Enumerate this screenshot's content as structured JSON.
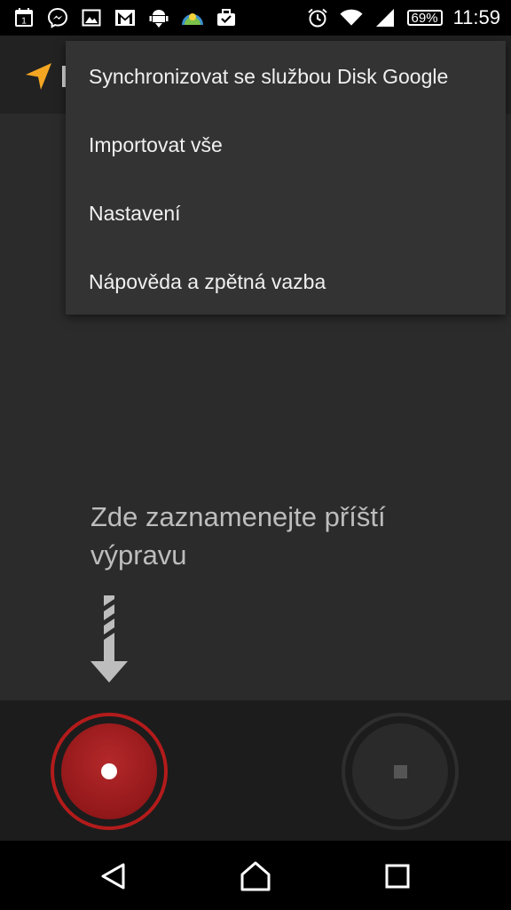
{
  "status_bar": {
    "icons": [
      "calendar-icon",
      "messenger-icon",
      "gallery-icon",
      "gmail-icon",
      "android-download-icon",
      "weather-icon",
      "briefcase-icon",
      "alarm-icon",
      "wifi-icon",
      "signal-icon"
    ],
    "calendar_day": "1",
    "battery": "69%",
    "time": "11:59"
  },
  "app_bar": {
    "icon": "navigation-arrow-icon",
    "accent_color": "#f4a622"
  },
  "overflow_menu": {
    "items": [
      {
        "label": "Synchronizovat se službou Disk Google"
      },
      {
        "label": "Importovat vše"
      },
      {
        "label": "Nastavení"
      },
      {
        "label": "Nápověda a zpětná vazba"
      }
    ]
  },
  "main": {
    "prompt_line1": "Zde zaznamenejte příští",
    "prompt_line2": "výpravu",
    "arrow_icon": "down-arrow-icon"
  },
  "controls": {
    "record_color": "#b31b1b",
    "record_icon": "record-icon",
    "stop_icon": "stop-icon"
  },
  "nav_bar": {
    "icons": [
      "back-icon",
      "home-icon",
      "recents-icon"
    ]
  }
}
